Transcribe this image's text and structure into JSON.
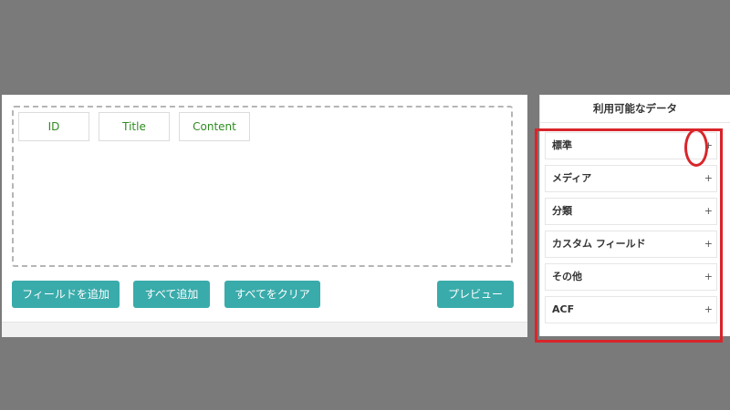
{
  "fields": {
    "chips": [
      "ID",
      "Title",
      "Content"
    ]
  },
  "buttons": {
    "add_field": "フィールドを追加",
    "add_all": "すべて追加",
    "clear_all": "すべてをクリア",
    "preview": "プレビュー"
  },
  "sidebar": {
    "title": "利用可能なデータ",
    "plus_symbol": "+",
    "items": [
      {
        "label": "標準"
      },
      {
        "label": "メディア"
      },
      {
        "label": "分類"
      },
      {
        "label": "カスタム フィールド"
      },
      {
        "label": "その他"
      },
      {
        "label": "ACF"
      }
    ]
  },
  "colors": {
    "background": "#7a7a7a",
    "button": "#3aabab",
    "chip_text": "#2e8b1f",
    "highlight": "#d9252a"
  },
  "icons": {
    "expand": "plus-icon"
  }
}
